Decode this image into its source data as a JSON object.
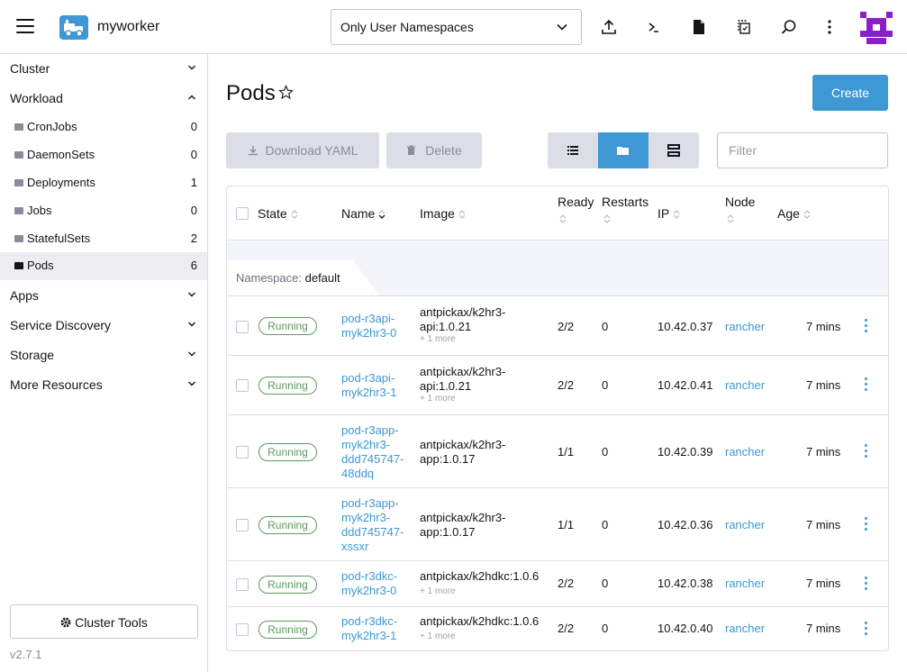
{
  "header": {
    "cluster_name": "myworker",
    "namespace_filter": "Only User Namespaces",
    "icons": [
      "import-yaml-icon",
      "kubectl-shell-icon",
      "kubeconfig-icon",
      "copy-kubeconfig-icon",
      "search-icon",
      "more-icon"
    ]
  },
  "sidebar": {
    "groups": [
      {
        "label": "Cluster",
        "expanded": false
      },
      {
        "label": "Workload",
        "expanded": true
      },
      {
        "label": "Apps",
        "expanded": false
      },
      {
        "label": "Service Discovery",
        "expanded": false
      },
      {
        "label": "Storage",
        "expanded": false
      },
      {
        "label": "More Resources",
        "expanded": false
      }
    ],
    "workload_items": [
      {
        "label": "CronJobs",
        "count": "0"
      },
      {
        "label": "DaemonSets",
        "count": "0"
      },
      {
        "label": "Deployments",
        "count": "1"
      },
      {
        "label": "Jobs",
        "count": "0"
      },
      {
        "label": "StatefulSets",
        "count": "2"
      },
      {
        "label": "Pods",
        "count": "6",
        "active": true
      }
    ],
    "cluster_tools": "Cluster Tools",
    "version": "v2.7.1"
  },
  "main": {
    "title": "Pods",
    "create_label": "Create",
    "download_label": "Download YAML",
    "delete_label": "Delete",
    "filter_placeholder": "Filter",
    "group_mode": "namespace"
  },
  "table": {
    "columns": [
      "State",
      "Name",
      "Image",
      "Ready",
      "Restarts",
      "IP",
      "Node",
      "Age"
    ],
    "namespace_prefix": "Namespace:",
    "namespace": "default",
    "rows": [
      {
        "state": "Running",
        "name": [
          "pod-r3api-",
          "myk2hr3-0"
        ],
        "image": [
          "antpickax/k2hr3-",
          "api:1.0.21"
        ],
        "more": "+ 1 more",
        "ready": "2/2",
        "restarts": "0",
        "ip": "10.42.0.37",
        "node": "rancher",
        "age": "7 mins"
      },
      {
        "state": "Running",
        "name": [
          "pod-r3api-",
          "myk2hr3-1"
        ],
        "image": [
          "antpickax/k2hr3-",
          "api:1.0.21"
        ],
        "more": "+ 1 more",
        "ready": "2/2",
        "restarts": "0",
        "ip": "10.42.0.41",
        "node": "rancher",
        "age": "7 mins"
      },
      {
        "state": "Running",
        "name": [
          "pod-r3app-",
          "myk2hr3-",
          "ddd745747-",
          "48ddq"
        ],
        "image": [
          "antpickax/k2hr3-",
          "app:1.0.17"
        ],
        "more": "",
        "ready": "1/1",
        "restarts": "0",
        "ip": "10.42.0.39",
        "node": "rancher",
        "age": "7 mins"
      },
      {
        "state": "Running",
        "name": [
          "pod-r3app-",
          "myk2hr3-",
          "ddd745747-",
          "xssxr"
        ],
        "image": [
          "antpickax/k2hr3-",
          "app:1.0.17"
        ],
        "more": "",
        "ready": "1/1",
        "restarts": "0",
        "ip": "10.42.0.36",
        "node": "rancher",
        "age": "7 mins"
      },
      {
        "state": "Running",
        "name": [
          "pod-r3dkc-",
          "myk2hr3-0"
        ],
        "image": [
          "antpickax/k2hdkc:1.0.6"
        ],
        "more": "+ 1 more",
        "ready": "2/2",
        "restarts": "0",
        "ip": "10.42.0.38",
        "node": "rancher",
        "age": "7 mins"
      },
      {
        "state": "Running",
        "name": [
          "pod-r3dkc-",
          "myk2hr3-1"
        ],
        "image": [
          "antpickax/k2hdkc:1.0.6"
        ],
        "more": "+ 1 more",
        "ready": "2/2",
        "restarts": "0",
        "ip": "10.42.0.40",
        "node": "rancher",
        "age": "7 mins"
      }
    ]
  },
  "colors": {
    "accent": "#3d98d3",
    "running": "#5d995d",
    "disabled_button": "#dcdee7"
  }
}
